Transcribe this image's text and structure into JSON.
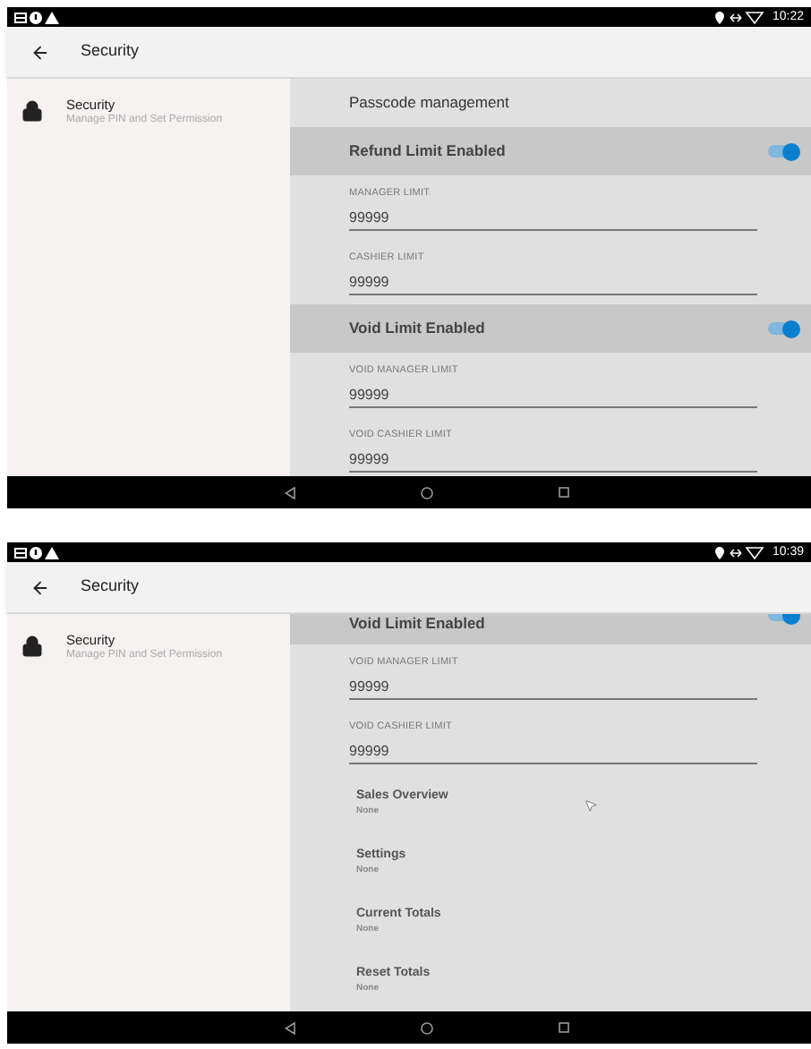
{
  "screens": [
    {
      "status_bar": {
        "time": "10:22"
      },
      "toolbar": {
        "title": "Security"
      },
      "sidebar": {
        "items": [
          {
            "title": "Security",
            "subtitle": "Manage PIN and Set Permission",
            "selected": true
          }
        ]
      },
      "pointer_visible": false,
      "content": [
        {
          "kind": "header",
          "title": "Passcode management"
        },
        {
          "kind": "toggle",
          "title": "Refund Limit Enabled",
          "on": true
        },
        {
          "kind": "field",
          "label": "MANAGER LIMIT",
          "value": "99999"
        },
        {
          "kind": "field",
          "label": "CASHIER LIMIT",
          "value": "99999"
        },
        {
          "kind": "toggle",
          "title": "Void Limit Enabled",
          "on": true
        },
        {
          "kind": "field",
          "label": "VOID MANAGER LIMIT",
          "value": "99999"
        },
        {
          "kind": "field",
          "label": "VOID CASHIER LIMIT",
          "value": "99999"
        }
      ]
    },
    {
      "status_bar": {
        "time": "10:39"
      },
      "toolbar": {
        "title": "Security"
      },
      "sidebar": {
        "items": [
          {
            "title": "Security",
            "subtitle": "Manage PIN and Set Permission",
            "selected": true
          }
        ]
      },
      "pointer_visible": true,
      "content": [
        {
          "kind": "toggle_partial",
          "title": "Void Limit Enabled",
          "on": true
        },
        {
          "kind": "field",
          "label": "VOID MANAGER LIMIT",
          "value": "99999"
        },
        {
          "kind": "field",
          "label": "VOID CASHIER LIMIT",
          "value": "99999"
        },
        {
          "kind": "info",
          "title": "Sales Overview",
          "subtitle": "None"
        },
        {
          "kind": "info",
          "title": "Settings",
          "subtitle": "None"
        },
        {
          "kind": "info",
          "title": "Current Totals",
          "subtitle": "None"
        },
        {
          "kind": "info",
          "title": "Reset Totals",
          "subtitle": "None"
        }
      ]
    }
  ]
}
